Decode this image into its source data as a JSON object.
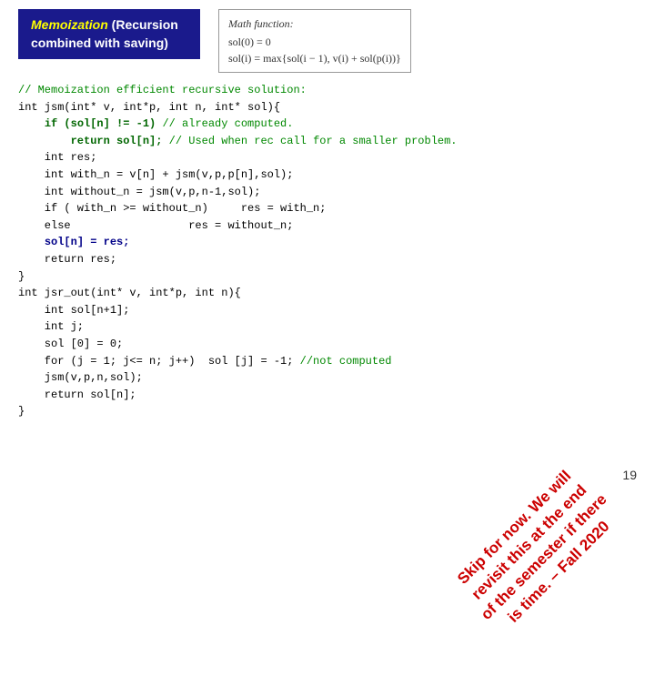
{
  "header": {
    "title_part1": "Memoization",
    "title_part2": " (Recursion",
    "title_part3": "combined with saving)",
    "math_title": "Math function:",
    "math_line1": "sol(0) = 0",
    "math_line2": "sol(i) = max{sol(i − 1), v(i) + sol(p(i))}"
  },
  "code": {
    "comment_line": "// Memoization efficient recursive solution:",
    "lines": [
      "int jsm(int* v, int*p, int n, int* sol){",
      "    if (sol[n] != -1) // already computed.",
      "        return sol[n]; // Used when rec call for a smaller problem.",
      "    int res;",
      "    int with_n = v[n] + jsm(v,p,p[n],sol);",
      "    int without_n = jsm(v,p,n-1,sol);",
      "    if ( with_n >= without_n)     res = with_n;",
      "    else                  res = without_n;",
      "    sol[n] = res;",
      "    return res;",
      "}",
      "int jsr_out(int* v, int*p, int n){",
      "    int sol[n+1];",
      "    int j;",
      "    sol [0] = 0;",
      "    for (j = 1; j<= n; j++)  sol [j] = -1; //not computed",
      "    jsm(v,p,n,sol);",
      "    return sol[n];",
      "}"
    ]
  },
  "watermark": {
    "line1": "Skip for now. We will revisit this at the end",
    "text": "Skip for now. We will\nrevisit this at the end\nof the semester if there\nis time. – Fall 2020"
  },
  "page_number": "19"
}
